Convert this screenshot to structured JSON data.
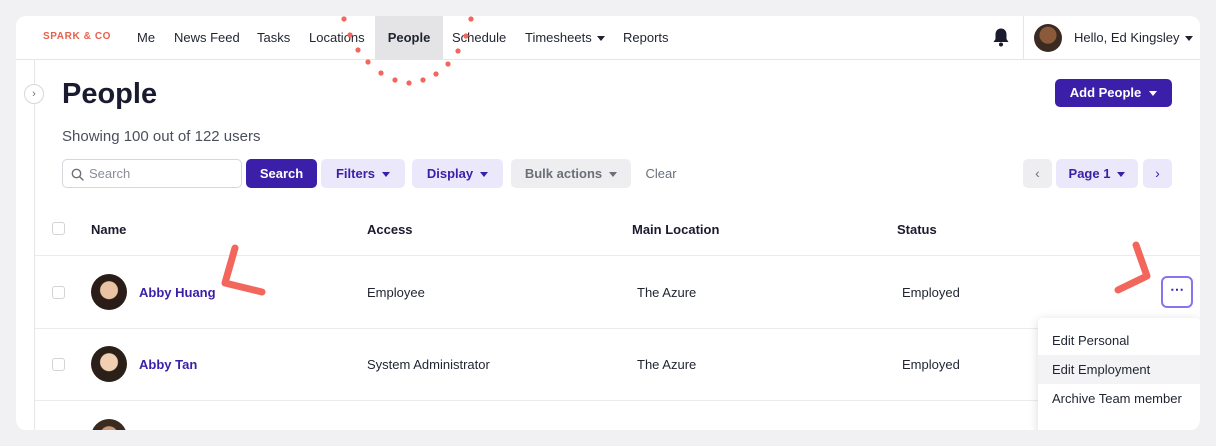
{
  "brand": "SPARK & CO",
  "nav": {
    "items": [
      "Me",
      "News Feed",
      "Tasks",
      "Locations",
      "People",
      "Schedule",
      "Timesheets",
      "Reports"
    ],
    "active": "People",
    "greeting": "Hello, Ed Kingsley"
  },
  "header": {
    "title": "People",
    "add_button": "Add People",
    "showing": "Showing 100 out of 122 users"
  },
  "toolbar": {
    "search_placeholder": "Search",
    "search_button": "Search",
    "filters": "Filters",
    "display": "Display",
    "bulk_actions": "Bulk actions",
    "clear": "Clear",
    "page": "Page 1"
  },
  "table": {
    "columns": [
      "Name",
      "Access",
      "Main Location",
      "Status"
    ],
    "rows": [
      {
        "name": "Abby Huang",
        "access": "Employee",
        "location": "The Azure",
        "status": "Employed"
      },
      {
        "name": "Abby Tan",
        "access": "System Administrator",
        "location": "The Azure",
        "status": "Employed"
      }
    ]
  },
  "row_menu": {
    "items": [
      "Edit Personal",
      "Edit Employment",
      "Archive Team member"
    ],
    "hovered": "Edit Employment"
  },
  "colors": {
    "brand": "#e8604c",
    "primary": "#3b1fa8",
    "annotation": "#f2665c"
  }
}
